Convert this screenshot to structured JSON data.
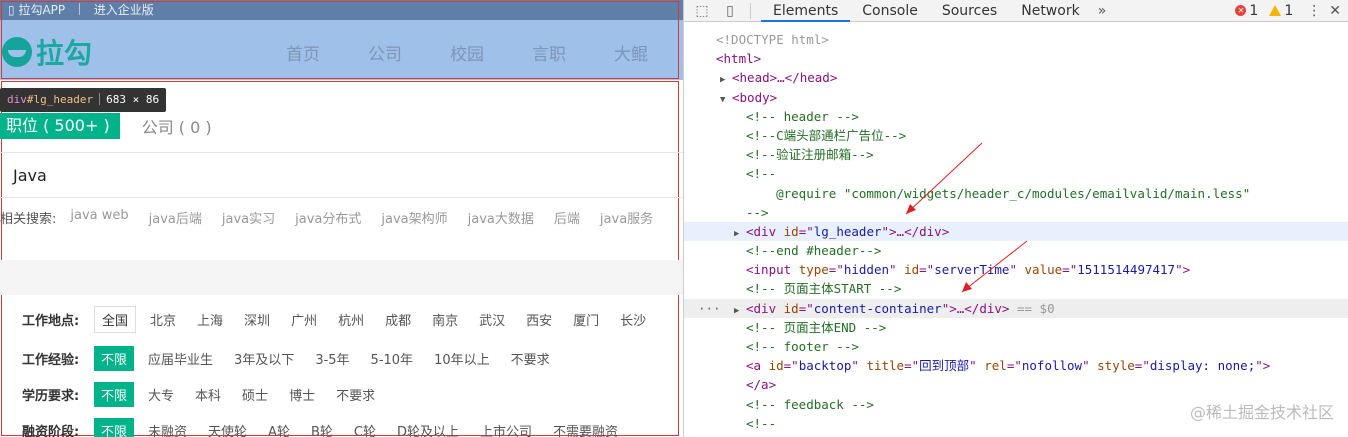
{
  "page": {
    "topbar": {
      "app": "拉勾APP",
      "enterprise": "进入企业版"
    },
    "logo_text": "拉勾",
    "nav": [
      "首页",
      "公司",
      "校园",
      "言职",
      "大鲲"
    ],
    "tooltip": {
      "tag": "div",
      "id": "#lg_header",
      "size": "683 × 86"
    },
    "tabs": {
      "positions": "职位 ( 500+ )",
      "companies": "公司 ( 0 )"
    },
    "search_value": "Java",
    "related": {
      "label": "相关搜索:",
      "keywords": [
        "java web",
        "java后端",
        "java实习",
        "java分布式",
        "java架构师",
        "java大数据",
        "后端",
        "java服务"
      ]
    },
    "filters": [
      {
        "label": "工作地点:",
        "options": [
          "全国",
          "北京",
          "上海",
          "深圳",
          "广州",
          "杭州",
          "成都",
          "南京",
          "武汉",
          "西安",
          "厦门",
          "长沙"
        ],
        "selected": 0,
        "style": "box"
      },
      {
        "label": "工作经验:",
        "options": [
          "不限",
          "应届毕业生",
          "3年及以下",
          "3-5年",
          "5-10年",
          "10年以上",
          "不要求"
        ],
        "selected": 0,
        "style": "sel"
      },
      {
        "label": "学历要求:",
        "options": [
          "不限",
          "大专",
          "本科",
          "硕士",
          "博士",
          "不要求"
        ],
        "selected": 0,
        "style": "sel"
      },
      {
        "label": "融资阶段:",
        "options": [
          "不限",
          "未融资",
          "天使轮",
          "A轮",
          "B轮",
          "C轮",
          "D轮及以上",
          "上市公司",
          "不需要融资"
        ],
        "selected": 0,
        "style": "sel"
      }
    ]
  },
  "devtools": {
    "tabs": [
      "Elements",
      "Console",
      "Sources",
      "Network"
    ],
    "active_tab": "Elements",
    "errors": "1",
    "warnings": "1",
    "watermark": "@稀土掘金技术社区"
  },
  "dom_lines": [
    {
      "t": "<!DOCTYPE html>",
      "c": "mu",
      "ind": 32
    },
    {
      "t": "<html>",
      "c": "tg",
      "ind": 32
    },
    {
      "t": "▶<head>…</head>",
      "c": "tg",
      "ind": 36
    },
    {
      "t": "▼<body>",
      "c": "tg",
      "ind": 36
    },
    {
      "t": "<!-- header -->",
      "c": "cm",
      "ind": 62
    },
    {
      "t": "<!--C端头部通栏广告位-->",
      "c": "cm",
      "ind": 62
    },
    {
      "t": "<!--验证注册邮箱-->",
      "c": "cm",
      "ind": 62
    },
    {
      "t": "<!--",
      "c": "cm",
      "ind": 62
    },
    {
      "t": "    @require \"common/widgets/header_c/modules/emailvalid/main.less\"",
      "c": "cm",
      "ind": 62
    },
    {
      "t": "-->",
      "c": "cm",
      "ind": 62
    },
    {
      "t": "div_lg_header",
      "c": "special",
      "ind": 50
    },
    {
      "t": "<!--end #header-->",
      "c": "cm",
      "ind": 62
    },
    {
      "t": "input_serverTime",
      "c": "special",
      "ind": 62
    },
    {
      "t": "<!-- 页面主体START -->",
      "c": "cm",
      "ind": 62
    },
    {
      "t": "div_content_container",
      "c": "special",
      "ind": 50
    },
    {
      "t": "<!-- 页面主体END -->",
      "c": "cm",
      "ind": 62
    },
    {
      "t": "<!-- footer -->",
      "c": "cm",
      "ind": 62
    },
    {
      "t": "a_backtop",
      "c": "special",
      "ind": 62
    },
    {
      "t": "</a>",
      "c": "tg",
      "ind": 62
    },
    {
      "t": "<!-- feedback -->",
      "c": "cm",
      "ind": 62
    },
    {
      "t": "<!--",
      "c": "cm",
      "ind": 62
    }
  ],
  "special": {
    "div_lg_header": {
      "id": "lg_header"
    },
    "input_serverTime": {
      "type": "hidden",
      "id": "serverTime",
      "value": "1511514497417"
    },
    "div_content_container": {
      "id": "content-container",
      "suffix": "== $0"
    },
    "a_backtop": {
      "id": "backtop",
      "title": "回到顶部",
      "rel": "nofollow",
      "style": "display: none;"
    }
  }
}
